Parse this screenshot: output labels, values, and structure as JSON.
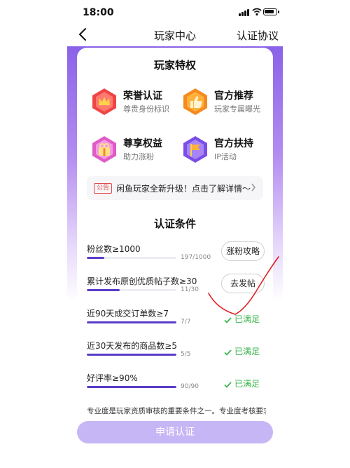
{
  "status": {
    "time": "18:00"
  },
  "nav": {
    "title": "玩家中心",
    "right_link": "认证协议"
  },
  "perks": {
    "title": "玩家特权",
    "items": [
      {
        "name": "荣誉认证",
        "desc": "尊贵身份标识",
        "icon": "crown-badge-icon",
        "color": "#f04545"
      },
      {
        "name": "官方推荐",
        "desc": "玩家专属曝光",
        "icon": "thumbs-up-badge-icon",
        "color": "#f58a1f"
      },
      {
        "name": "尊享权益",
        "desc": "助力涨粉",
        "icon": "gift-badge-icon",
        "color": "#e05bc8"
      },
      {
        "name": "官方扶持",
        "desc": "IP活动",
        "icon": "flag-badge-icon",
        "color": "#7a4de8"
      }
    ]
  },
  "notice": {
    "tag": "公告",
    "text": "闲鱼玩家全新升级！点击了解详情～"
  },
  "conditions": {
    "title": "认证条件",
    "items": [
      {
        "label": "粉丝数≥1000",
        "count": "197/1000",
        "progress": 0.197,
        "action": "涨粉攻略"
      },
      {
        "label": "累计发布原创优质帖子数≥30",
        "count": "11/30",
        "progress": 0.367,
        "action": "去发帖"
      },
      {
        "label": "近90天成交订单数≥7",
        "count": "7/7",
        "progress": 1.0,
        "status": "已满足"
      },
      {
        "label": "近30天发布的商品数≥5",
        "count": "5/5",
        "progress": 1.0,
        "status": "已满足"
      },
      {
        "label": "好评率≥90%",
        "count": "90/90",
        "progress": 1.0,
        "status": "已满足"
      }
    ]
  },
  "footer_note": "专业度是玩家资质审核的重要条件之一。专业度考核要求",
  "apply_button": "申请认证",
  "colors": {
    "accent": "#5b3cc8",
    "success": "#39b54a",
    "apply_bg": "#c7b6f5",
    "annotation": "#e02020"
  }
}
